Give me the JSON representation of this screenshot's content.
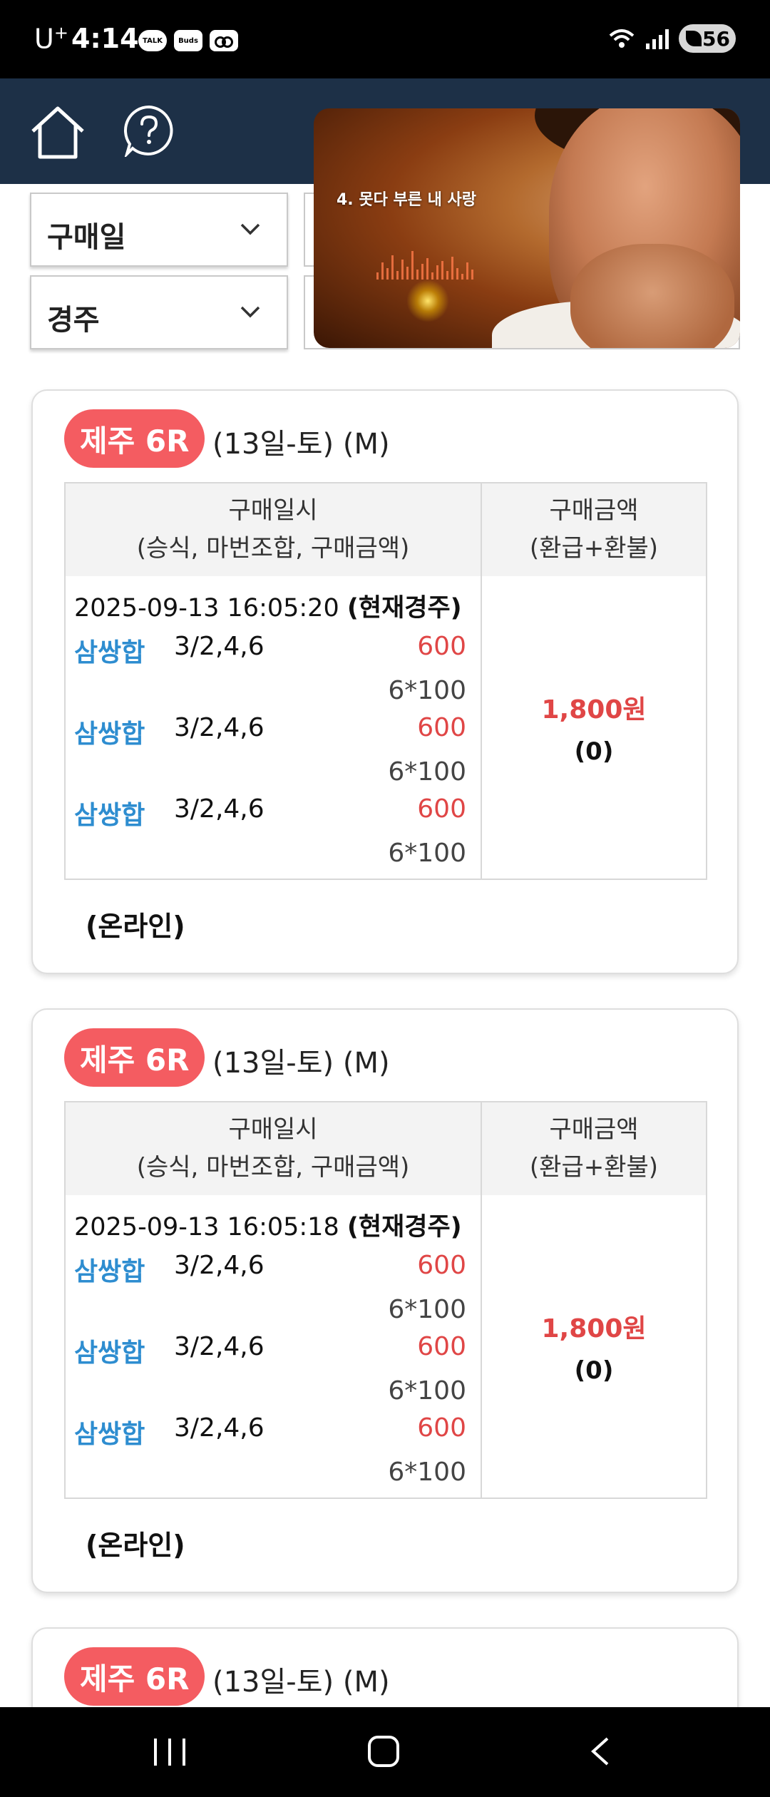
{
  "status_bar": {
    "carrier": "U",
    "carrier_plus": "+",
    "time": "4:14",
    "talk_label": "TALK",
    "buds_label": "Buds",
    "battery": "56",
    "icons": [
      "kakaotalk-icon",
      "buds-icon",
      "voicemail-icon",
      "wifi-icon",
      "signal-icon",
      "battery-icon"
    ]
  },
  "header": {
    "icons": [
      "home-icon",
      "help-icon"
    ]
  },
  "filters": {
    "date_label": "구매일",
    "race_label": "경주"
  },
  "video_overlay": {
    "track_title": "4. 못다 부른 내 사랑"
  },
  "colors": {
    "header_bg": "#1d3047",
    "badge_bg": "#f45c61",
    "bet_type": "#2e8dd0",
    "amount": "#e04646"
  },
  "table_headers": {
    "col1_line1": "구매일시",
    "col1_line2": "(승식, 마번조합, 구매금액)",
    "col2_line1": "구매금액",
    "col2_line2": "(환급+환불)"
  },
  "cards": [
    {
      "badge": "제주 6R",
      "info": "(13일-토) (M)",
      "timestamp": "2025-09-13 16:05:20",
      "current_label": "(현재경주)",
      "bets": [
        {
          "type": "삼쌍합",
          "numbers": "3/2,4,6",
          "amount": "600",
          "calc": "6*100"
        },
        {
          "type": "삼쌍합",
          "numbers": "3/2,4,6",
          "amount": "600",
          "calc": "6*100"
        },
        {
          "type": "삼쌍합",
          "numbers": "3/2,4,6",
          "amount": "600",
          "calc": "6*100"
        }
      ],
      "total": "1,800원",
      "refund": "(0)",
      "channel": "(온라인)"
    },
    {
      "badge": "제주 6R",
      "info": "(13일-토) (M)",
      "timestamp": "2025-09-13 16:05:18",
      "current_label": "(현재경주)",
      "bets": [
        {
          "type": "삼쌍합",
          "numbers": "3/2,4,6",
          "amount": "600",
          "calc": "6*100"
        },
        {
          "type": "삼쌍합",
          "numbers": "3/2,4,6",
          "amount": "600",
          "calc": "6*100"
        },
        {
          "type": "삼쌍합",
          "numbers": "3/2,4,6",
          "amount": "600",
          "calc": "6*100"
        }
      ],
      "total": "1,800원",
      "refund": "(0)",
      "channel": "(온라인)"
    },
    {
      "badge": "제주 6R",
      "info": "(13일-토) (M)"
    }
  ],
  "nav_bar": {
    "icons": [
      "recent-apps-icon",
      "home-circle-icon",
      "back-icon"
    ]
  }
}
